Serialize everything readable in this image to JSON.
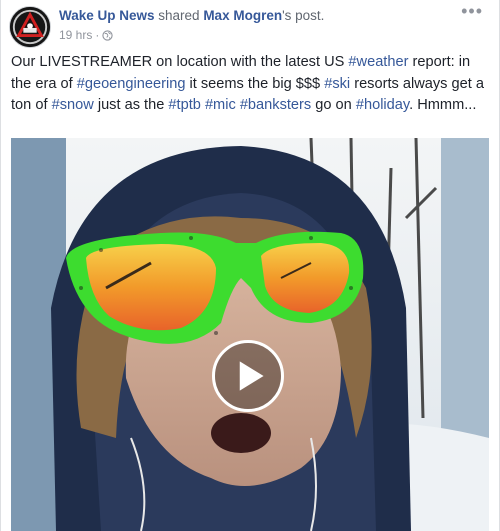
{
  "post": {
    "page_name": "Wake Up News",
    "shared_text": " shared ",
    "original_author": "Max Mogren",
    "possessive": "'s post.",
    "timestamp": "19 hrs",
    "separator": "·",
    "more_label": "•••",
    "text_segments": [
      {
        "type": "text",
        "value": "Our LIVESTREAMER on location with the latest US "
      },
      {
        "type": "tag",
        "value": "#weather"
      },
      {
        "type": "text",
        "value": " report: in the era of "
      },
      {
        "type": "tag",
        "value": "#geoengineering"
      },
      {
        "type": "text",
        "value": " it seems the big $$$ "
      },
      {
        "type": "tag",
        "value": "#ski"
      },
      {
        "type": "text",
        "value": " resorts always get a ton of "
      },
      {
        "type": "tag",
        "value": "#snow"
      },
      {
        "type": "text",
        "value": " just as the "
      },
      {
        "type": "tag",
        "value": "#tptb"
      },
      {
        "type": "text",
        "value": " "
      },
      {
        "type": "tag",
        "value": "#mic"
      },
      {
        "type": "text",
        "value": " "
      },
      {
        "type": "tag",
        "value": "#banksters"
      },
      {
        "type": "text",
        "value": " go on "
      },
      {
        "type": "tag",
        "value": "#holiday"
      },
      {
        "type": "text",
        "value": ". Hmmm..."
      }
    ]
  },
  "icons": {
    "privacy": "globe-icon",
    "play": "play-icon",
    "avatar": "page-avatar"
  },
  "colors": {
    "link": "#365899",
    "meta": "#90949c",
    "text": "#1d2129",
    "sunglasses_frame": "#3ddc2f",
    "lens": "#f5a623"
  }
}
